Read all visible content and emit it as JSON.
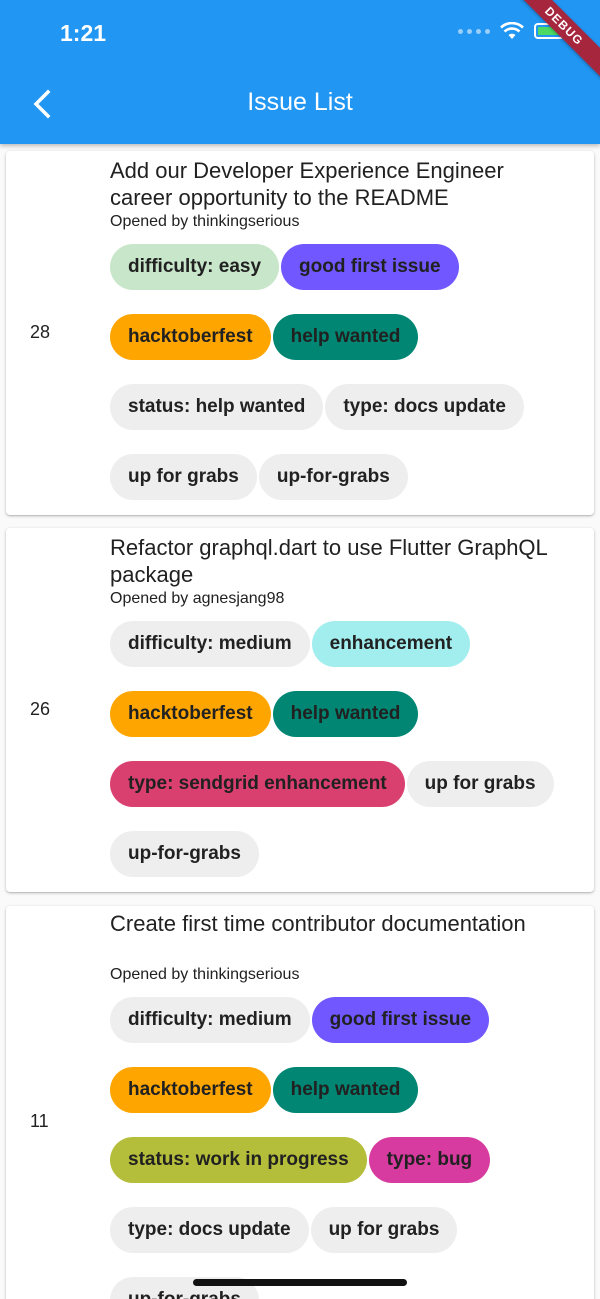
{
  "status_bar": {
    "time": "1:21"
  },
  "debug_banner": "DEBUG",
  "app_bar": {
    "title": "Issue List"
  },
  "colors": {
    "app_bar": "#2196f3",
    "chip_default": "#eeeeee",
    "difficulty_easy": "#c8e6c9",
    "good_first_issue": "#7057ff",
    "hacktoberfest": "#ffa500",
    "help_wanted": "#008672",
    "enhancement": "#a2eeef",
    "type_sendgrid_enhancement": "#d93f6f",
    "status_work_in_progress": "#b5be3a",
    "type_bug": "#d73ba0"
  },
  "issues": [
    {
      "number": "28",
      "title": "Add our Developer Experience Engineer career opportunity to the README",
      "author": "Opened by thinkingserious",
      "labels": [
        [
          "difficulty: easy",
          "good first issue"
        ],
        [
          "hacktoberfest",
          "help wanted"
        ],
        [
          "status: help wanted",
          "type: docs update"
        ],
        [
          "up for grabs",
          "up-for-grabs"
        ]
      ]
    },
    {
      "number": "26",
      "title": "Refactor graphql.dart to use Flutter GraphQL package",
      "author": "Opened by agnesjang98",
      "labels": [
        [
          "difficulty: medium",
          "enhancement"
        ],
        [
          "hacktoberfest",
          "help wanted"
        ],
        [
          "type: sendgrid enhancement",
          "up for grabs"
        ],
        [
          "up-for-grabs"
        ]
      ]
    },
    {
      "number": "11",
      "title": "Create first time contributor documentation",
      "author": "Opened by thinkingserious",
      "labels": [
        [
          "difficulty: medium",
          "good first issue"
        ],
        [
          "hacktoberfest",
          "help wanted"
        ],
        [
          "status: work in progress",
          "type: bug"
        ],
        [
          "type: docs update",
          "up for grabs"
        ],
        [
          "up-for-grabs"
        ]
      ]
    }
  ]
}
